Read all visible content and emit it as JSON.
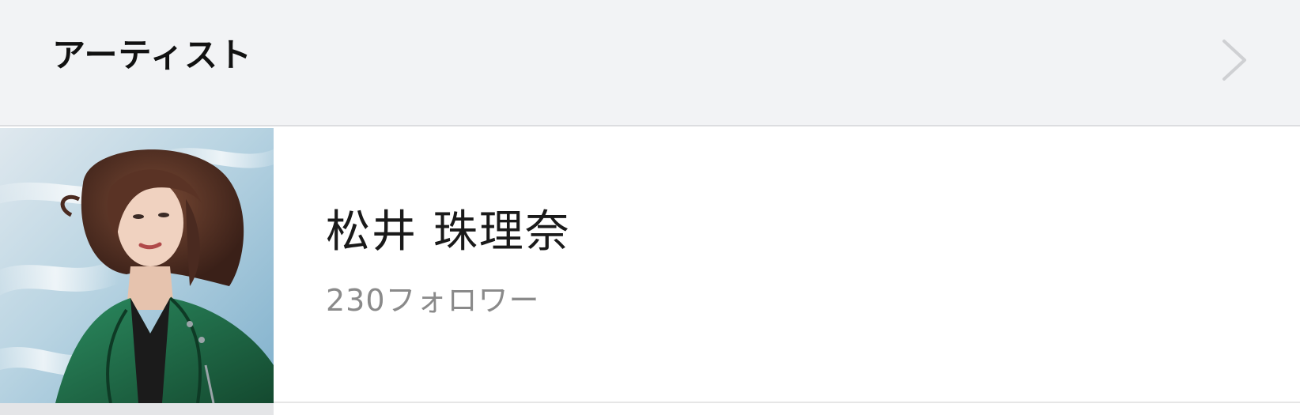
{
  "section": {
    "title": "アーティスト",
    "chevron_icon": "chevron-right-icon"
  },
  "artist": {
    "name": "松井 珠理奈",
    "followers": "230フォロワー",
    "avatar_icon": "artist-photo"
  },
  "colors": {
    "header_bg": "#f2f3f5",
    "divider": "#dcdde0",
    "name_text": "#1a1a1a",
    "secondary_text": "#8a8a8a",
    "jacket": "#1f6b48"
  }
}
